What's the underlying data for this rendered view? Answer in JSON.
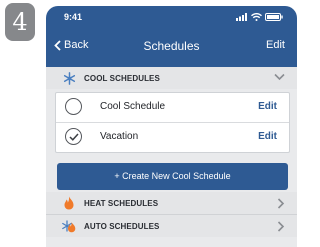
{
  "step_number": "4",
  "status_bar": {
    "time": "9:41"
  },
  "nav": {
    "back_label": "Back",
    "title": "Schedules",
    "edit_label": "Edit"
  },
  "cool_section": {
    "label": "COOL SCHEDULES",
    "icon": "snowflake-icon",
    "expanded": true,
    "items": [
      {
        "label": "Cool Schedule",
        "edit_label": "Edit",
        "selected": false
      },
      {
        "label": "Vacation",
        "edit_label": "Edit",
        "selected": true
      }
    ],
    "create_button_label": "+ Create New Cool Schedule"
  },
  "heat_section": {
    "label": "HEAT SCHEDULES",
    "icon": "flame-icon"
  },
  "auto_section": {
    "label": "AUTO SCHEDULES",
    "icon": "flame-snowflake-icon"
  },
  "colors": {
    "header_blue": "#2e5a93",
    "icon_blue": "#4a7fc0",
    "flame_orange": "#f07a2a"
  }
}
